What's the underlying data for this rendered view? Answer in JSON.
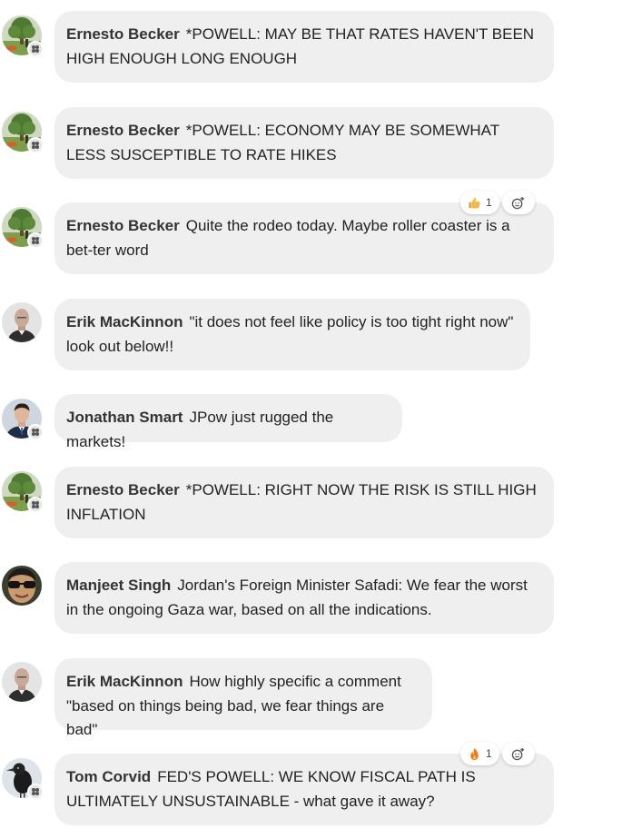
{
  "messages": [
    {
      "author": "Ernesto Becker",
      "text": "*POWELL: MAY BE THAT RATES HAVEN'T BEEN HIGH ENOUGH LONG ENOUGH",
      "avatar": "tree-avatar"
    },
    {
      "author": "Ernesto Becker",
      "text": "*POWELL: ECONOMY MAY BE SOMEWHAT LESS SUSCEPTIBLE TO RATE HIKES",
      "avatar": "tree-avatar"
    },
    {
      "author": "Ernesto Becker",
      "text": "Quite the rodeo today. Maybe roller coaster is a bet-ter word",
      "avatar": "tree-avatar",
      "reaction": {
        "icon": "thumbs-up-icon",
        "count": "1"
      }
    },
    {
      "author": "Erik MacKinnon",
      "text": "\"it does not feel like policy is too tight right now\" look out below!!",
      "avatar": "bald-man-avatar"
    },
    {
      "author": "Jonathan Smart",
      "text": "JPow just rugged the markets!",
      "avatar": "suit-man-avatar"
    },
    {
      "author": "Ernesto Becker",
      "text": "*POWELL: RIGHT NOW THE RISK IS STILL HIGH INFLATION",
      "avatar": "tree-avatar"
    },
    {
      "author": "Manjeet Singh",
      "text": "Jordan's Foreign Minister Safadi: We fear the worst in the ongoing Gaza war, based on all the indications.",
      "avatar": "sunglasses-avatar"
    },
    {
      "author": "Erik MacKinnon",
      "text": "How highly specific a comment \"based on things being bad, we fear things are bad\"",
      "avatar": "bald-man-avatar"
    },
    {
      "author": "Tom Corvid",
      "text": "FED'S POWELL: WE KNOW FISCAL PATH IS ULTIMATELY UNSUSTAINABLE - what gave it away?",
      "avatar": "crow-avatar",
      "reaction": {
        "icon": "fire-icon",
        "count": "1"
      }
    }
  ],
  "colors": {
    "bubble": "#efefef",
    "author": "#333333",
    "text": "#222222"
  }
}
